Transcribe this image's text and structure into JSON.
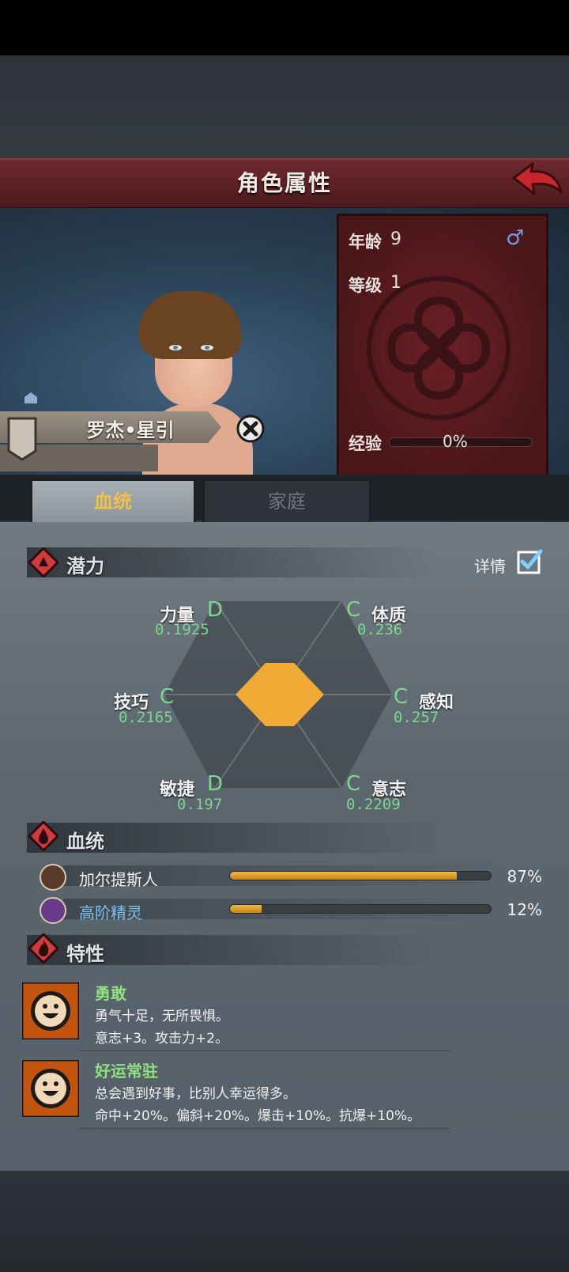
{
  "screen": {
    "title": "角色属性"
  },
  "character": {
    "name": "罗杰•星引",
    "age_label": "年龄",
    "age": "9",
    "gender_symbol": "♂",
    "level_label": "等级",
    "level": "1",
    "exp_label": "经验",
    "exp_text": "0%",
    "exp_progress": 0
  },
  "tabs": [
    {
      "label": "血统",
      "active": true
    },
    {
      "label": "家庭",
      "active": false
    }
  ],
  "potential": {
    "title": "潜力",
    "detail_label": "详情",
    "detail_checked": true,
    "stats": [
      {
        "name": "力量",
        "grade": "D",
        "value": "0.1925"
      },
      {
        "name": "体质",
        "grade": "C",
        "value": "0.236"
      },
      {
        "name": "技巧",
        "grade": "C",
        "value": "0.2165"
      },
      {
        "name": "感知",
        "grade": "C",
        "value": "0.257"
      },
      {
        "name": "敏捷",
        "grade": "D",
        "value": "0.197"
      },
      {
        "name": "意志",
        "grade": "C",
        "value": "0.2209"
      }
    ]
  },
  "bloodline": {
    "title": "血统",
    "items": [
      {
        "name": "加尔提斯人",
        "percent_text": "87%",
        "percent": 87,
        "name_color": "#f0f0f0"
      },
      {
        "name": "高阶精灵",
        "percent_text": "12%",
        "percent": 12,
        "name_color": "#7fc0f0"
      }
    ]
  },
  "traits": {
    "title": "特性",
    "items": [
      {
        "name": "勇敢",
        "desc1": "勇气十足，无所畏惧。",
        "desc2": "意志+3。攻击力+2。"
      },
      {
        "name": "好运常驻",
        "desc1": "总会遇到好事，比别人幸运得多。",
        "desc2": "命中+20%。偏斜+20%。爆击+10%。抗爆+10%。"
      }
    ]
  },
  "colors": {
    "title_band": "#5a2024",
    "radar_fill": "#f0aa35",
    "grade_text": "#7fd690",
    "trait_name": "#8fe07f",
    "tab_active_text": "#f0c048"
  }
}
